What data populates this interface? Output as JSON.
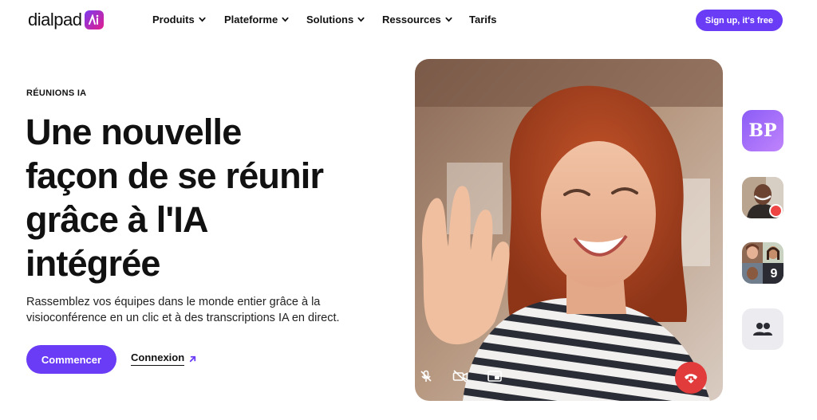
{
  "nav": {
    "logo": "dialpad",
    "items": [
      {
        "label": "Produits",
        "dropdown": true
      },
      {
        "label": "Plateforme",
        "dropdown": true
      },
      {
        "label": "Solutions",
        "dropdown": true
      },
      {
        "label": "Ressources",
        "dropdown": true
      },
      {
        "label": "Tarifs",
        "dropdown": false
      }
    ],
    "signup": "Sign up, it's free"
  },
  "hero": {
    "eyebrow": "RÉUNIONS IA",
    "headline": [
      "Une nouvelle",
      "façon de se réunir",
      "grâce à l'IA",
      "intégrée"
    ],
    "subtext": "Rassemblez vos équipes dans le monde entier grâce à la visioconférence en un clic et à des transcriptions IA en direct.",
    "cta_primary": "Commencer",
    "cta_secondary": "Connexion"
  },
  "participants": {
    "initials": "BP",
    "more_count": "9"
  },
  "colors": {
    "brand": "#6b3cf5",
    "hangup": "#e23b3b",
    "recording": "#ef4444"
  },
  "icons": [
    "chevron-down-icon",
    "arrow-up-right-icon",
    "mic-off-icon",
    "video-off-icon",
    "picture-in-picture-icon",
    "hang-up-icon",
    "people-icon"
  ]
}
